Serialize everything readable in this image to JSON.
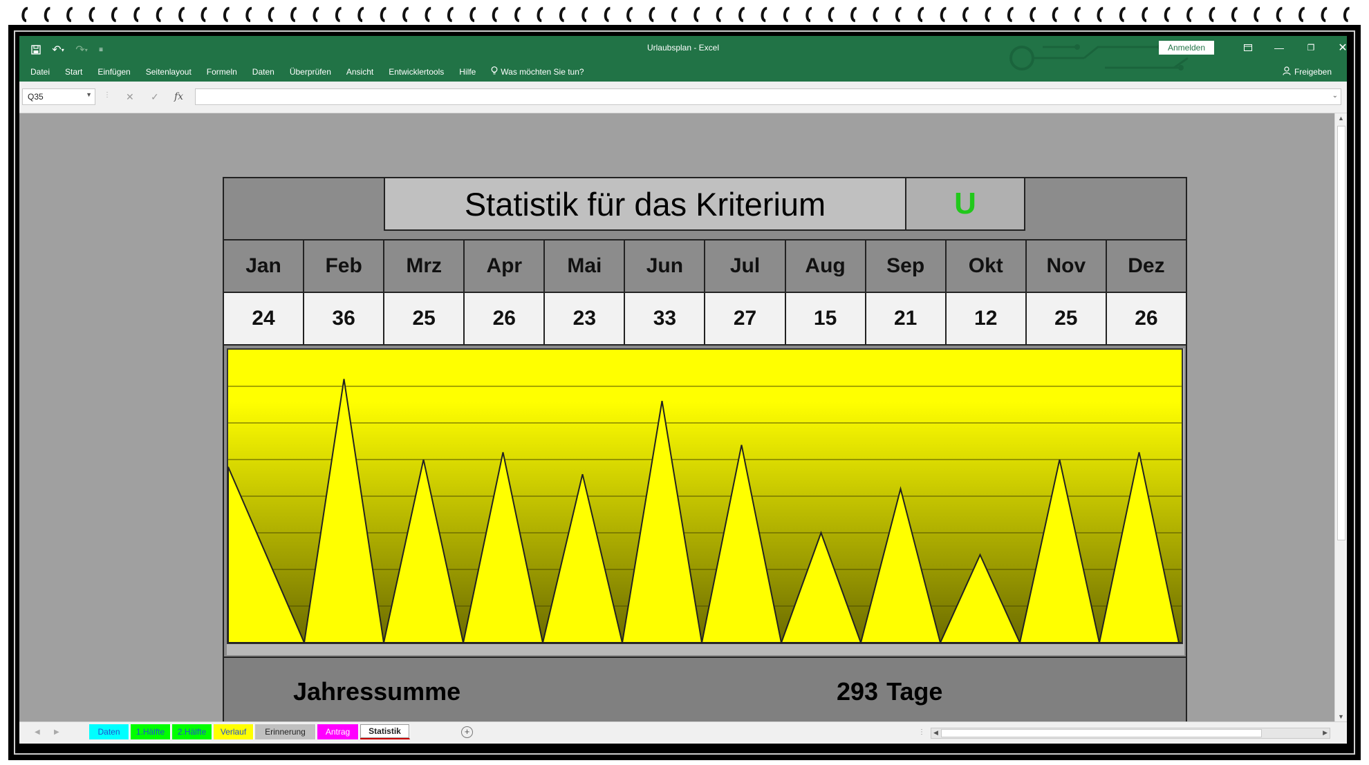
{
  "window": {
    "title": "Urlaubsplan  -  Excel",
    "signin_label": "Anmelden",
    "minimize_icon": "minimize-icon",
    "restore_icon": "restore-icon",
    "close_icon": "close-icon"
  },
  "ribbon": {
    "tabs": [
      "Datei",
      "Start",
      "Einfügen",
      "Seitenlayout",
      "Formeln",
      "Daten",
      "Überprüfen",
      "Ansicht",
      "Entwicklertools",
      "Hilfe"
    ],
    "tell_me": "Was möchten Sie tun?",
    "share": "Freigeben"
  },
  "formula_bar": {
    "name_box": "Q35",
    "content": ""
  },
  "statistic": {
    "title": "Statistik für das Kriterium",
    "criterion": "U",
    "criterion_color": "#21c81b",
    "total_label": "Jahressumme",
    "total_value": "293",
    "total_unit": "Tage"
  },
  "colors": {
    "excel_green": "#217346",
    "chart_fill": "#ffff00",
    "chart_bg_top": "#ffff00",
    "chart_bg_bottom": "#6b6b00"
  },
  "chart_data": {
    "type": "area",
    "categories": [
      "Jan",
      "Feb",
      "Mrz",
      "Apr",
      "Mai",
      "Jun",
      "Jul",
      "Aug",
      "Sep",
      "Okt",
      "Nov",
      "Dez"
    ],
    "values": [
      24,
      36,
      25,
      26,
      23,
      33,
      27,
      15,
      21,
      12,
      25,
      26
    ],
    "ylim": [
      0,
      40
    ],
    "grid": true,
    "style": "spikes"
  },
  "sheet_tabs": [
    {
      "label": "Daten",
      "color": "#00ffff",
      "text_color": "#1f4fd0",
      "active": false
    },
    {
      "label": "1.Hälfte",
      "color": "#00ff00",
      "text_color": "#1f4fd0",
      "active": false
    },
    {
      "label": "2.Hälfte",
      "color": "#00ff00",
      "text_color": "#1f4fd0",
      "active": false
    },
    {
      "label": "Verlauf",
      "color": "#ffff00",
      "text_color": "#1f4fd0",
      "active": false
    },
    {
      "label": "Erinnerung",
      "color": "#c0c0c0",
      "text_color": "#222222",
      "active": false
    },
    {
      "label": "Antrag",
      "color": "#ff00ff",
      "text_color": "#ffffff",
      "active": false
    },
    {
      "label": "Statistik",
      "color": "#ffffff",
      "text_color": "#222222",
      "active": true
    }
  ]
}
